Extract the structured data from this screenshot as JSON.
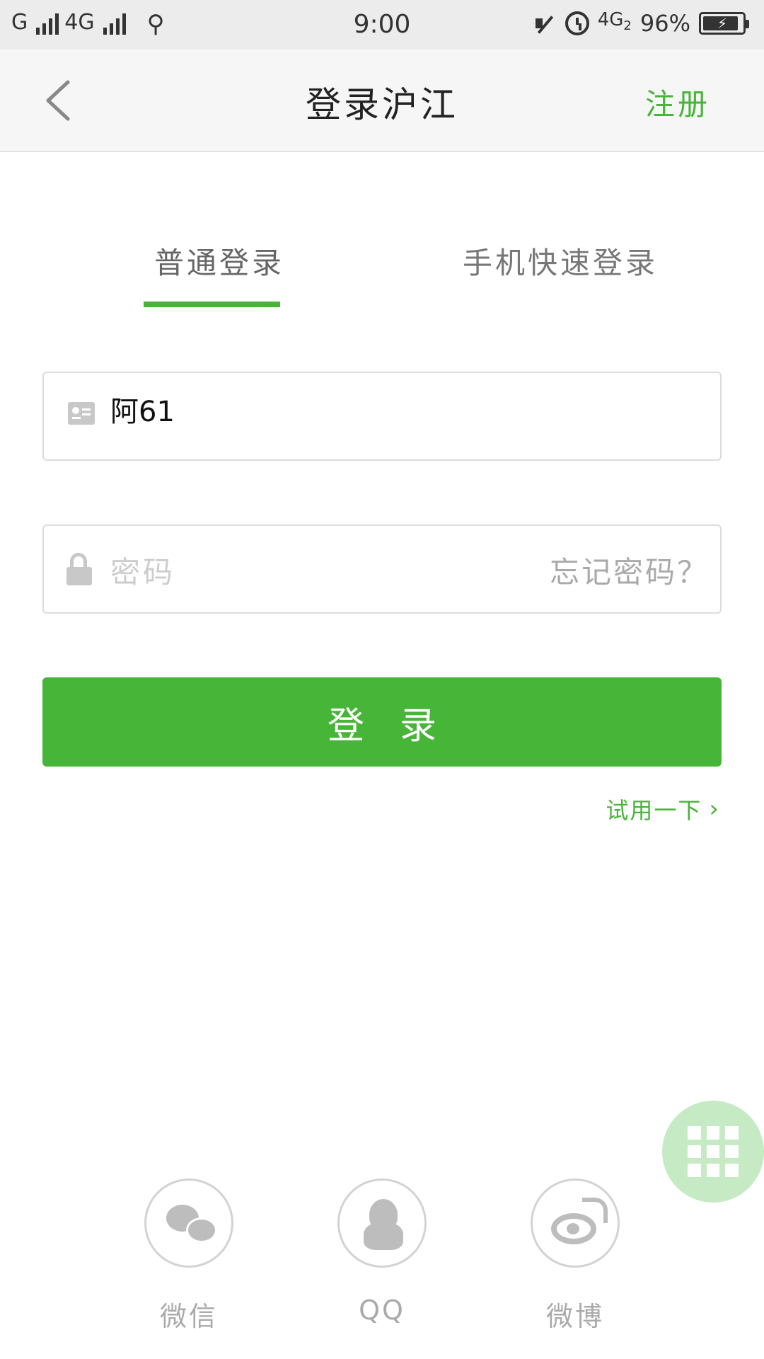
{
  "status_bar": {
    "carrier1": "G",
    "carrier2": "4G",
    "usb_icon": "⚲",
    "time": "9:00",
    "network": "4G",
    "network_sub": "2",
    "battery": "96%"
  },
  "header": {
    "title": "登录沪江",
    "register_label": "注册"
  },
  "tabs": [
    {
      "label": "普通登录",
      "active": true
    },
    {
      "label": "手机快速登录",
      "active": false
    }
  ],
  "form": {
    "username_value": "阿61",
    "password_placeholder": "密码",
    "forgot_label": "忘记密码？"
  },
  "login_button_label": "登录",
  "trial_label": "试用一下",
  "social": [
    {
      "label": "微信",
      "icon": "wechat-icon"
    },
    {
      "label": "QQ",
      "icon": "qq-icon"
    },
    {
      "label": "微博",
      "icon": "weibo-icon"
    }
  ],
  "colors": {
    "accent": "#47b538",
    "fab": "#c5eac4"
  }
}
